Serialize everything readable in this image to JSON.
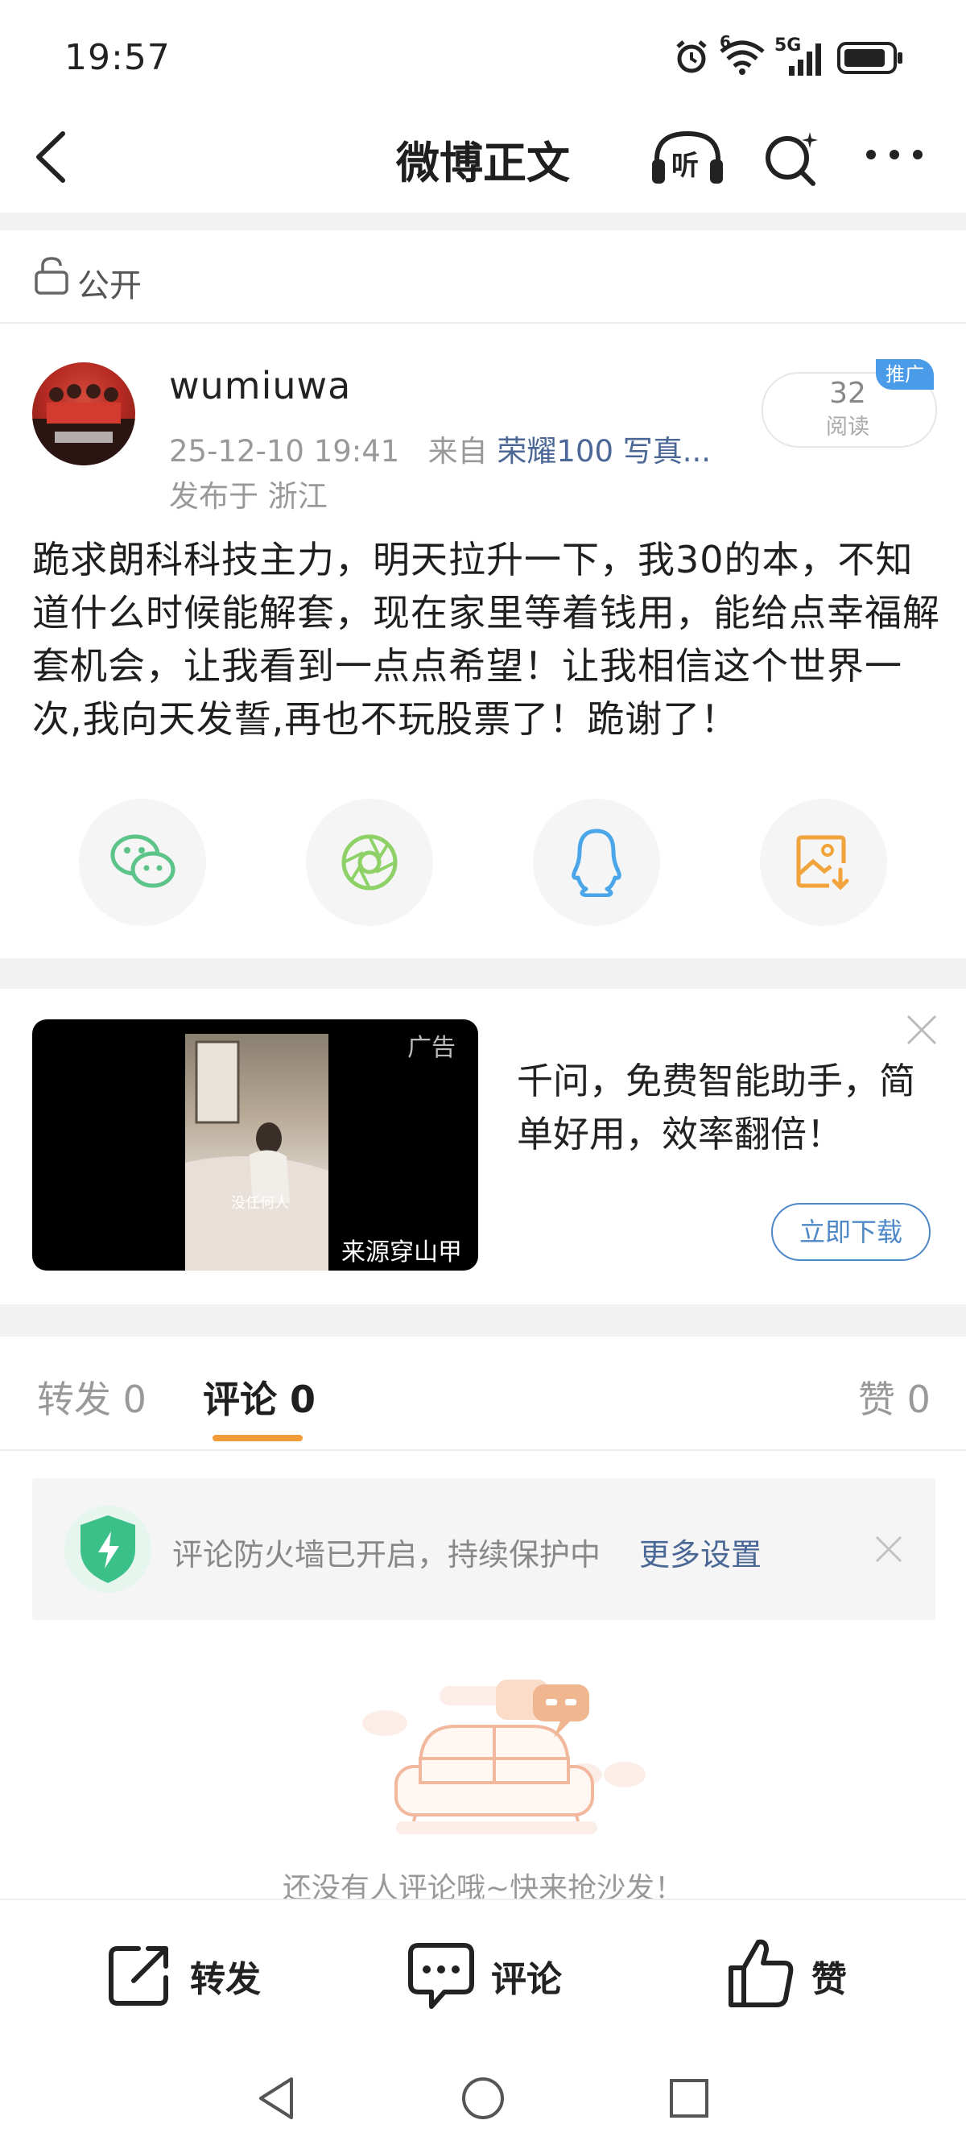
{
  "status_bar": {
    "time": "19:57",
    "network_label": "5G",
    "wifi_badge": "6"
  },
  "nav": {
    "title": "微博正文",
    "listen_label": "听"
  },
  "visibility": {
    "label": "公开"
  },
  "post": {
    "username": "wumiuwa",
    "date": "25-12-10 19:41",
    "source_prefix": "来自",
    "source": "荣耀100 写真...",
    "region": "发布于 浙江",
    "read_count": "32",
    "read_label": "阅读",
    "promo_badge": "推广",
    "text": "跪求朗科科技主力，明天拉升一下，我30的本，不知道什么时候能解套，现在家里等着钱用，能给点幸福解套机会，让我看到一点点希望！让我相信这个世界一次,我向天发誓,再也不玩股票了！跪谢了！"
  },
  "share": {
    "items": [
      "wechat-icon",
      "moments-icon",
      "qq-icon",
      "save-image-icon"
    ],
    "colors": {
      "wechat": "#5cc489",
      "moments": "#8dd167",
      "qq": "#4aa6e8",
      "save": "#f1a43b"
    }
  },
  "ad": {
    "tag": "广告",
    "source": "来源穿山甲",
    "caption": "没任何人",
    "title": "千问，免费智能助手，简单好用，效率翻倍！",
    "button": "立即下载"
  },
  "tabs": {
    "repost": "转发 0",
    "comment": "评论 0",
    "like": "赞 0"
  },
  "firewall": {
    "text": "评论防火墙已开启，持续保护中",
    "link": "更多设置"
  },
  "empty": {
    "text": "还没有人评论哦~快来抢沙发！"
  },
  "bottom_actions": {
    "repost": "转发",
    "comment": "评论",
    "like": "赞"
  },
  "colors": {
    "accent_orange": "#f29c38",
    "link_blue": "#4a6795",
    "button_blue": "#4f88c7",
    "shield_green": "#3cc08a"
  }
}
